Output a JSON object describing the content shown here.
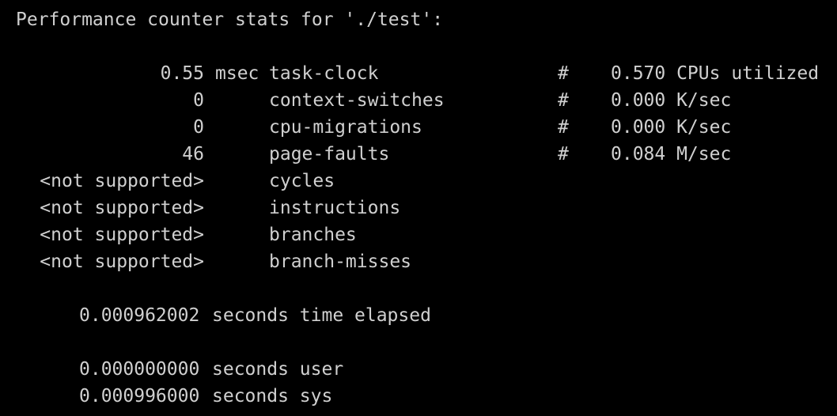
{
  "terminal": {
    "background_color": "#000000",
    "text_color": "#d0d0d0",
    "header": "Performance counter stats for './test':",
    "events": [
      {
        "value": "0.55",
        "unit": "msec",
        "name": "task-clock",
        "hash": "#",
        "comment": "0.570 CPUs utilized"
      },
      {
        "value": "0",
        "unit": "",
        "name": "context-switches",
        "hash": "#",
        "comment": "0.000 K/sec"
      },
      {
        "value": "0",
        "unit": "",
        "name": "cpu-migrations",
        "hash": "#",
        "comment": "0.000 K/sec"
      },
      {
        "value": "46",
        "unit": "",
        "name": "page-faults",
        "hash": "#",
        "comment": "0.084 M/sec"
      },
      {
        "value": "<not supported>",
        "unit": "",
        "name": "cycles",
        "hash": "",
        "comment": ""
      },
      {
        "value": "<not supported>",
        "unit": "",
        "name": "instructions",
        "hash": "",
        "comment": ""
      },
      {
        "value": "<not supported>",
        "unit": "",
        "name": "branches",
        "hash": "",
        "comment": ""
      },
      {
        "value": "<not supported>",
        "unit": "",
        "name": "branch-misses",
        "hash": "",
        "comment": ""
      }
    ],
    "timing": [
      {
        "value": "0.000962002",
        "label": "seconds time elapsed"
      },
      {
        "value": "0.000000000",
        "label": "seconds user"
      },
      {
        "value": "0.000996000",
        "label": "seconds sys"
      }
    ]
  }
}
